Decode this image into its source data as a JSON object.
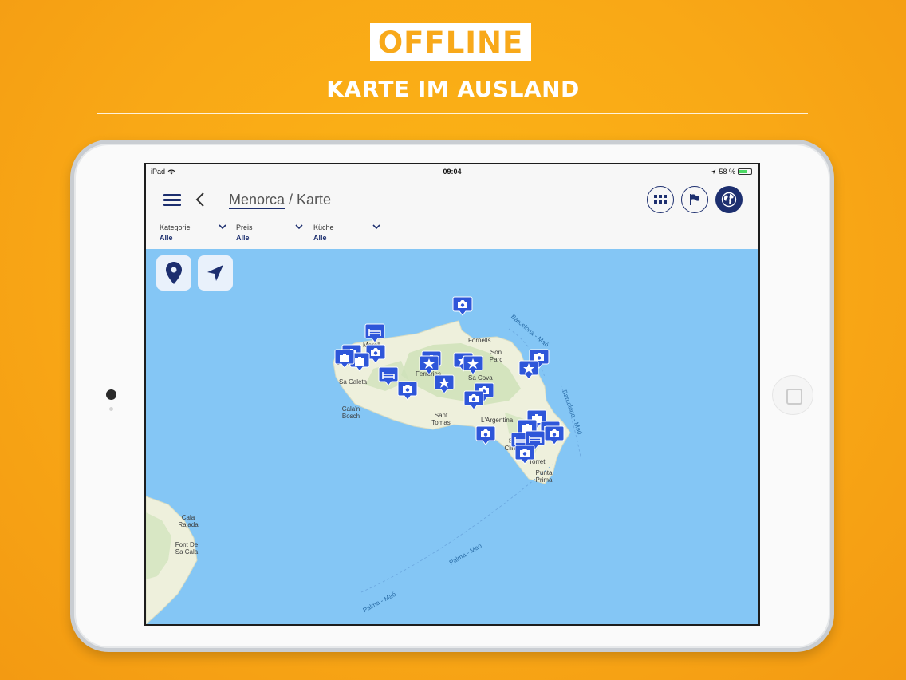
{
  "promo": {
    "headline": "OFFLINE",
    "subheadline": "KARTE IM AUSLAND"
  },
  "statusbar": {
    "device": "iPad",
    "time": "09:04",
    "battery": "58 %"
  },
  "navbar": {
    "title_link": "Menorca",
    "title_separator": " / ",
    "title_current": "Karte"
  },
  "filters": [
    {
      "label": "Kategorie",
      "value": "Alle"
    },
    {
      "label": "Preis",
      "value": "Alle"
    },
    {
      "label": "Küche",
      "value": "Alle"
    }
  ],
  "icons": {
    "menu": "hamburger-menu-icon",
    "back": "chevron-left-icon",
    "grid": "grid-icon",
    "flag": "flag-icon",
    "globe": "globe-icon",
    "location_pin": "location-pin-icon",
    "navigate": "navigation-arrow-icon"
  },
  "colors": {
    "brand_navy": "#1d2f6f",
    "promo_orange": "#f8a91a",
    "sea": "#84c6f5",
    "land": "#eef0dc",
    "marker": "#2e56d9"
  },
  "map_labels": {
    "places": [
      "Fornells",
      "Son Parc",
      "Morell",
      "Ciutadella",
      "Ferreries",
      "Sa Cova",
      "Sa Caleta",
      "Cala'n Bosch",
      "Sant Tomas",
      "L'Argentina",
      "Sant Climent",
      "Torret",
      "Punta Prima",
      "Cala Rajada",
      "Font De Sa Cala"
    ],
    "sea_routes": [
      "Barcelona - Maó",
      "Barcelona - Maó",
      "Palma - Maó",
      "Palma - Maó"
    ]
  }
}
